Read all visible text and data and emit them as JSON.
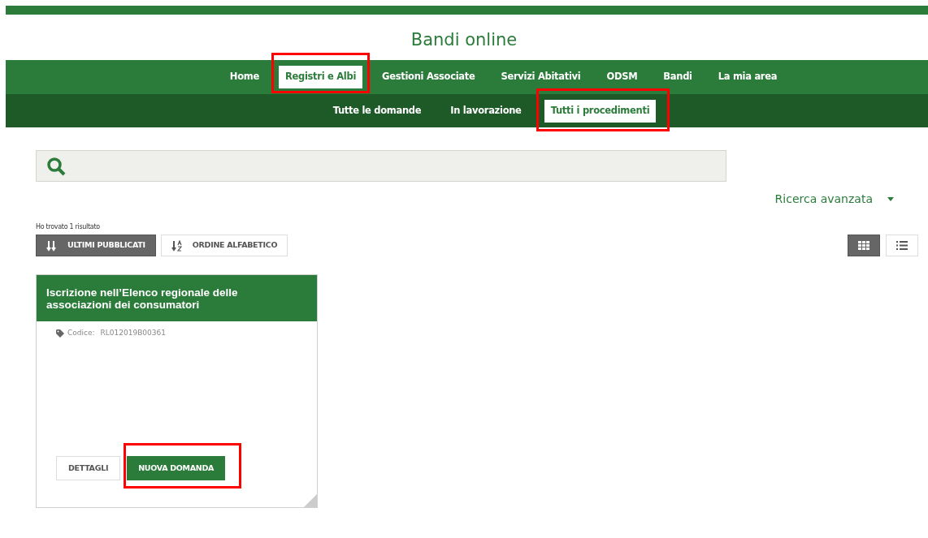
{
  "header": {
    "title": "Bandi online"
  },
  "main_nav": [
    {
      "label": "Home",
      "selected": false,
      "highlighted": false
    },
    {
      "label": "Registri e Albi",
      "selected": true,
      "highlighted": true
    },
    {
      "label": "Gestioni Associate",
      "selected": false,
      "highlighted": false
    },
    {
      "label": "Servizi Abitativi",
      "selected": false,
      "highlighted": false
    },
    {
      "label": "ODSM",
      "selected": false,
      "highlighted": false
    },
    {
      "label": "Bandi",
      "selected": false,
      "highlighted": false
    },
    {
      "label": "La mia area",
      "selected": false,
      "highlighted": false
    }
  ],
  "sub_nav": [
    {
      "label": "Tutte le domande",
      "selected": false,
      "highlighted": false
    },
    {
      "label": "In lavorazione",
      "selected": false,
      "highlighted": false
    },
    {
      "label": "Tutti i procedimenti",
      "selected": true,
      "highlighted": true
    }
  ],
  "advanced_search": {
    "label": "Ricerca avanzata"
  },
  "results": {
    "count_text": "Ho trovato 1 risultato"
  },
  "sort_buttons": [
    {
      "label": "ULTIMI PUBBLICATI",
      "kind": "date",
      "selected": true
    },
    {
      "label": "ORDINE ALFABETICO",
      "kind": "alpha",
      "selected": false
    }
  ],
  "view_toggles": [
    {
      "kind": "grid",
      "selected": true
    },
    {
      "kind": "list",
      "selected": false
    }
  ],
  "cards": [
    {
      "title": "Iscrizione nell’Elenco regionale delle associazioni dei consumatori",
      "code_label": "Codice:",
      "code": "RL012019B00361",
      "buttons": [
        {
          "label": "DETTAGLI",
          "kind": "secondary",
          "highlighted": false
        },
        {
          "label": "NUOVA DOMANDA",
          "kind": "primary",
          "highlighted": true
        }
      ]
    }
  ]
}
